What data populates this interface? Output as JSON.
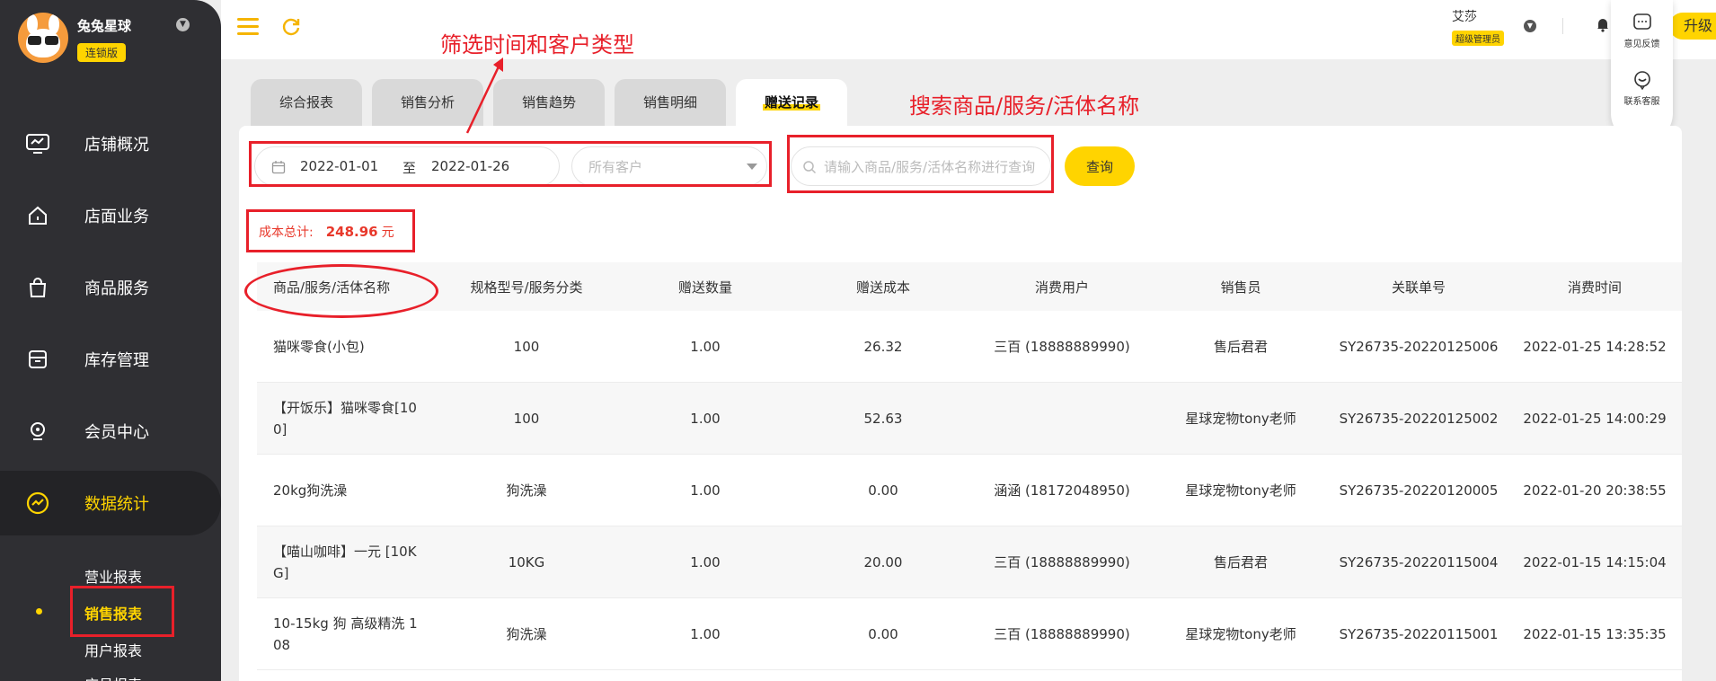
{
  "brand": {
    "name": "兔兔星球",
    "badge": "连锁版"
  },
  "sidebar": {
    "items": [
      {
        "label": "店铺概况",
        "icon": "dashboard-icon"
      },
      {
        "label": "店面业务",
        "icon": "home-icon"
      },
      {
        "label": "商品服务",
        "icon": "shopping-bag-icon"
      },
      {
        "label": "库存管理",
        "icon": "inventory-box-icon"
      },
      {
        "label": "会员中心",
        "icon": "member-icon"
      },
      {
        "label": "数据统计",
        "icon": "statistics-icon",
        "active": true
      }
    ],
    "sub_items": [
      {
        "label": "营业报表"
      },
      {
        "label": "销售报表",
        "active": true
      },
      {
        "label": "用户报表"
      },
      {
        "label": "店员报表"
      }
    ]
  },
  "topbar": {
    "user_name": "艾莎",
    "user_role": "超级管理员",
    "upgrade_label": "升级"
  },
  "float_panel": {
    "feedback_label": "意见反馈",
    "service_label": "联系客服"
  },
  "tabs": [
    {
      "label": "综合报表"
    },
    {
      "label": "销售分析"
    },
    {
      "label": "销售趋势"
    },
    {
      "label": "销售明细"
    },
    {
      "label": "赠送记录",
      "active": true
    }
  ],
  "filters": {
    "date_start": "2022-01-01",
    "date_sep": "至",
    "date_end": "2022-01-26",
    "customer_placeholder": "所有客户",
    "search_placeholder": "请输入商品/服务/活体名称进行查询",
    "query_label": "查询"
  },
  "summary": {
    "label": "成本总计:",
    "value": "248.96",
    "unit": "元"
  },
  "table": {
    "headers": [
      "商品/服务/活体名称",
      "规格型号/服务分类",
      "赠送数量",
      "赠送成本",
      "消费用户",
      "销售员",
      "关联单号",
      "消费时间"
    ],
    "rows": [
      [
        "猫咪零食(小包)",
        "100",
        "1.00",
        "26.32",
        "三百 (18888889990)",
        "售后君君",
        "SY26735-20220125006",
        "2022-01-25 14:28:52"
      ],
      [
        "【开饭乐】猫咪零食[100]",
        "100",
        "1.00",
        "52.63",
        "",
        "星球宠物tony老师",
        "SY26735-20220125002",
        "2022-01-25 14:00:29"
      ],
      [
        "20kg狗洗澡",
        "狗洗澡",
        "1.00",
        "0.00",
        "涵涵 (18172048950)",
        "星球宠物tony老师",
        "SY26735-20220120005",
        "2022-01-20 20:38:55"
      ],
      [
        "【喵山咖啡】一元 [10KG]",
        "10KG",
        "1.00",
        "20.00",
        "三百 (18888889990)",
        "售后君君",
        "SY26735-20220115004",
        "2022-01-15 14:15:04"
      ],
      [
        "10-15kg 狗 高级精洗 108",
        "狗洗澡",
        "1.00",
        "0.00",
        "三百 (18888889990)",
        "星球宠物tony老师",
        "SY26735-20220115001",
        "2022-01-15 13:35:35"
      ]
    ]
  },
  "annotations": {
    "filter_note": "筛选时间和客户类型",
    "search_note": "搜索商品/服务/活体名称",
    "color": "#e8202a"
  },
  "colors": {
    "accent": "#ffd400",
    "sidebar_bg": "#2f2f33",
    "danger": "#e8382b"
  }
}
